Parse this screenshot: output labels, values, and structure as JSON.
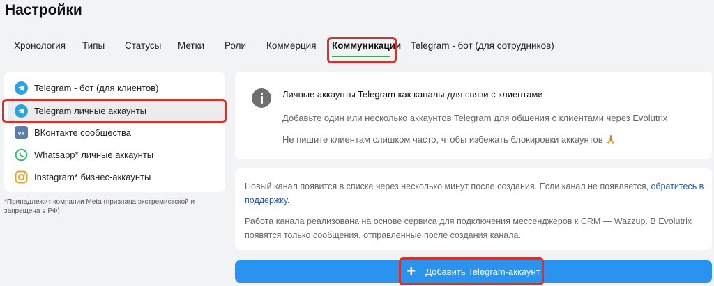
{
  "page_title": "Настройки",
  "tabs": [
    {
      "label": "Хронология"
    },
    {
      "label": "Типы"
    },
    {
      "label": "Статусы"
    },
    {
      "label": "Метки"
    },
    {
      "label": "Роли"
    },
    {
      "label": "Коммерция"
    },
    {
      "label": "Коммуникации",
      "active": true
    },
    {
      "label": "Telegram - бот (для сотрудников)"
    }
  ],
  "sidebar": {
    "items": [
      {
        "label": "Telegram - бот (для клиентов)",
        "icon": "telegram-icon"
      },
      {
        "label": "Telegram личные аккаунты",
        "icon": "telegram-icon",
        "active": true
      },
      {
        "label": "ВКонтакте сообщества",
        "icon": "vk-icon"
      },
      {
        "label": "Whatsapp* личные аккаунты",
        "icon": "whatsapp-icon"
      },
      {
        "label": "Instagram* бизнес-аккаунты",
        "icon": "instagram-icon"
      }
    ],
    "footnote": "*Принадлежит компании Meta (признана экстремистской и запрещена в РФ)"
  },
  "info_card": {
    "icon": "info-icon",
    "title": "Личные аккаунты Telegram как каналы для связи с клиентами",
    "line1": "Добавьте один или несколько аккаунтов Telegram для общения с клиентами через Evolutrix",
    "line2": "Не пишите клиентам слишком часто, чтобы избежать блокировки аккаунтов"
  },
  "notes_card": {
    "p1_text": "Новый канал появится в списке через несколько минут после создания. Если канал не появляется, ",
    "p1_link": "обратитесь в поддержку",
    "p1_end": ".",
    "p2_text": "Работа канала реализована на основе сервиса для подключения мессенджеров к CRM — Wazzup. В Evolutrix появятся только сообщения, отправленные после создания канала."
  },
  "add_button": {
    "label": "Добавить Telegram-аккаунт",
    "icon": "plus-icon"
  },
  "colors": {
    "accent_blue": "#2a93f0",
    "active_tab_underline": "#2db34a",
    "highlight_red": "#d8302b",
    "telegram": "#2aa3e0",
    "vk": "#5b7ea8",
    "whatsapp": "#25c16f",
    "instagram": "#e8a23a"
  }
}
